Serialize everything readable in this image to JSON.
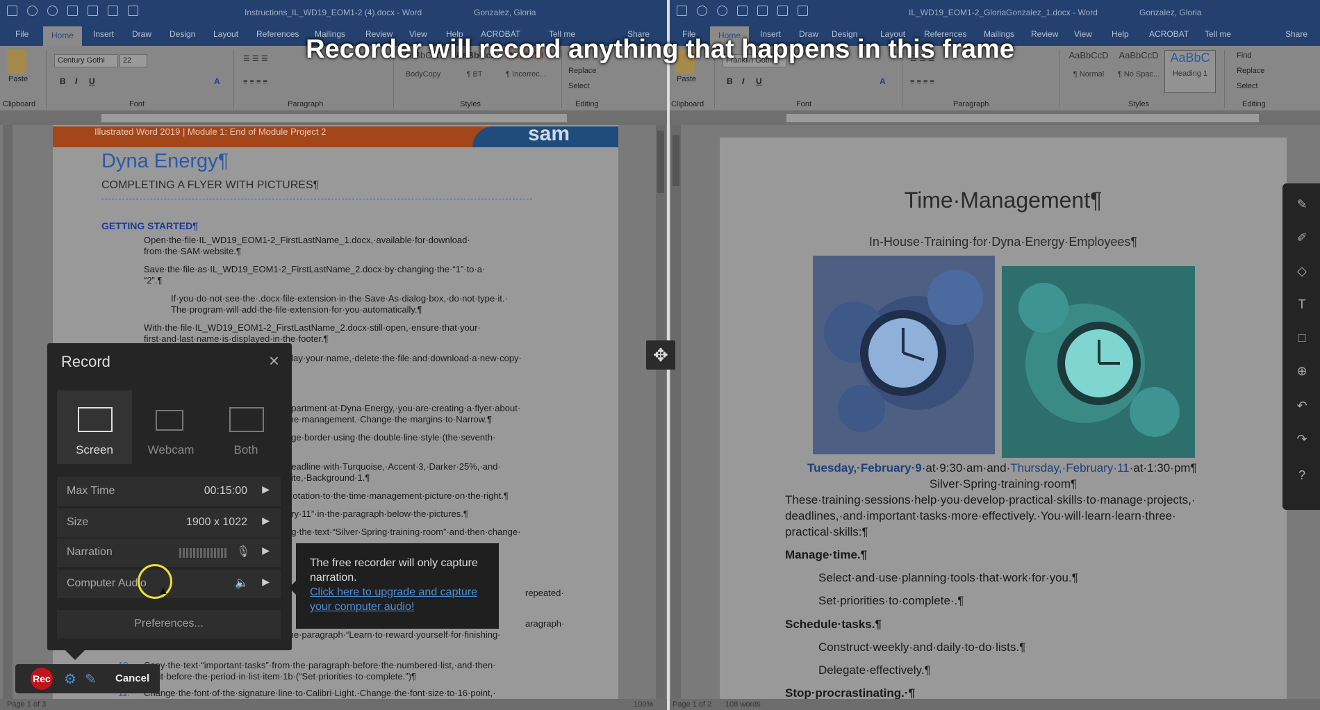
{
  "banner": "Recorder will record anything that happens in this frame",
  "left": {
    "title": "Instructions_IL_WD19_EOM1-2 (4).docx  -  Word",
    "user": "Gonzalez, Gloria",
    "tabs": [
      "File",
      "Home",
      "Insert",
      "Draw",
      "Design",
      "Layout",
      "References",
      "Mailings",
      "Review",
      "View",
      "Help",
      "ACROBAT",
      "Tell me",
      "Share"
    ],
    "font_name": "Century Gothi",
    "font_size": "22",
    "styles": [
      "AaBbCcD",
      "AaBbCcI",
      "AaBbCcI"
    ],
    "style_names": [
      "BodyCopy",
      "¶ BT",
      "¶ Incorrec..."
    ],
    "replace": "Replace",
    "select": "Select",
    "groups": [
      "Clipboard",
      "Font",
      "Paragraph",
      "Styles",
      "Editing"
    ],
    "paste": "Paste",
    "header_strip": "Illustrated Word 2019 | Module 1: End of Module Project 2",
    "header_logo": "sam",
    "doc_title": "Dyna Energy¶",
    "doc_sub": "COMPLETING A FLYER WITH PICTURES¶",
    "getting_started": "GETTING STARTED¶",
    "lines": [
      "Open·the·file·IL_WD19_EOM1-2_FirstLastName_1.docx,·available·for·download·",
      "from·the·SAM·website.¶",
      "Save·the·file·as·IL_WD19_EOM1-2_FirstLastName_2.docx·by·changing·the·“1”·to·a·",
      "“2”.¶",
      "If·you·do·not·see·the·.docx·file·extension·in·the·Save·As·dialog·box,·do·not·type·it.·",
      "The·program·will·add·the·file·extension·for·you·automatically.¶",
      "With·the·file·IL_WD19_EOM1-2_FirstLastName_2.docx·still·open,·ensure·that·your·",
      "first·and·last·name·is·displayed·in·the·footer.¶",
      "play·your·name,·delete·the·file·and·download·a·new·copy·",
      "epartment·at·Dyna·Energy,·you·are·creating·a·flyer·about·",
      "me·management.·Change·the·margins·to·Narrow.¶",
      "age·border·using·the·double·line·style·(the·seventh·",
      "headline·with·Turquoise,·Accent·3,·Darker·25%,·and·",
      "hite,·Background·1.¶",
      "Rotation·to·the·time·management·picture·on·the·right.¶",
      "ary·11”·in·the·paragraph·below·the·pictures.¶",
      "ng·the·text·“Silver·Spring·training·room”·and·then·change·",
      "repeated·",
      "aragraph·",
      "the·paragraph·“Learn·to·reward·yourself·for·finishing·",
      "Copy·the·text·“important·tasks”·from·the·paragraph·before·the·numbered·list,·and·then·",
      "ste·it·before·the·period·in·list·item·1b·(“Set·priorities·to·complete.”)¶",
      "Change·the·font·of·the·signature·line·to·Calibri·Light.·Change·the·font·size·to·16·point,·"
    ],
    "num10": "10.",
    "num11": "11.",
    "status": "Page 1 of 3",
    "zoom": "100%"
  },
  "right": {
    "title": "IL_WD19_EOM1-2_GloriaGonzalez_1.docx  -  Word",
    "user": "Gonzalez, Gloria",
    "tabs": [
      "File",
      "Home",
      "Insert",
      "Draw",
      "Design",
      "Layout",
      "References",
      "Mailings",
      "Review",
      "View",
      "Help",
      "ACROBAT",
      "Tell me",
      "Share"
    ],
    "font_name": "Franklin Gothi",
    "styles": [
      "AaBbCcD",
      "AaBbCcD",
      "AaBbC"
    ],
    "style_names": [
      "¶ Normal",
      "¶ No Spac...",
      "Heading 1"
    ],
    "find": "Find",
    "replace": "Replace",
    "select": "Select",
    "groups": [
      "Clipboard",
      "Font",
      "Paragraph",
      "Styles",
      "Editing"
    ],
    "paste": "Paste",
    "doc_title": "Time·Management¶",
    "doc_sub": "In-House·Training·for·Dyna·Energy·Employees¶",
    "date1": "Tuesday,·February·9",
    "time1": "·at·9:30·am·and·",
    "date2": "Thursday,·February·11",
    "time2": "·at·1:30·pm¶",
    "room": "Silver·Spring·training·room¶",
    "body": [
      "These·training·sessions·help·you·develop·practical·skills·to·manage·projects,·",
      "deadlines,·and·important·tasks·more·effectively.·You·will·learn·learn·three·",
      "practical·skills:¶"
    ],
    "h1": "Manage·time.¶",
    "i1a": "Select·and·use·planning·tools·that·work·for·you.¶",
    "i1b": "Set·priorities·to·complete·.¶",
    "h2": "Schedule·tasks.¶",
    "i2a": "Construct·weekly·and·daily·to-do·lists.¶",
    "i2b": "Delegate·effectively.¶",
    "h3": "Stop·procrastinating.·¶",
    "status": "Page 1 of 2",
    "words": "108 words"
  },
  "recorder": {
    "title": "Record",
    "modes": [
      "Screen",
      "Webcam",
      "Both"
    ],
    "max_time_label": "Max Time",
    "max_time": "00:15:00",
    "size_label": "Size",
    "size": "1900 x 1022",
    "narration_label": "Narration",
    "audio_label": "Computer Audio",
    "preferences": "Preferences...",
    "rec": "Rec",
    "cancel": "Cancel"
  },
  "tooltip": {
    "text": "The free recorder will only capture narration.",
    "link": "Click here to upgrade and capture your computer audio!"
  },
  "colors": {
    "title_blue": "#23406e",
    "heading_blue": "#2a5aa8",
    "dim_overlay": "#7a7a7a",
    "rec_red": "#c0141b",
    "link": "#4f8fd6"
  }
}
